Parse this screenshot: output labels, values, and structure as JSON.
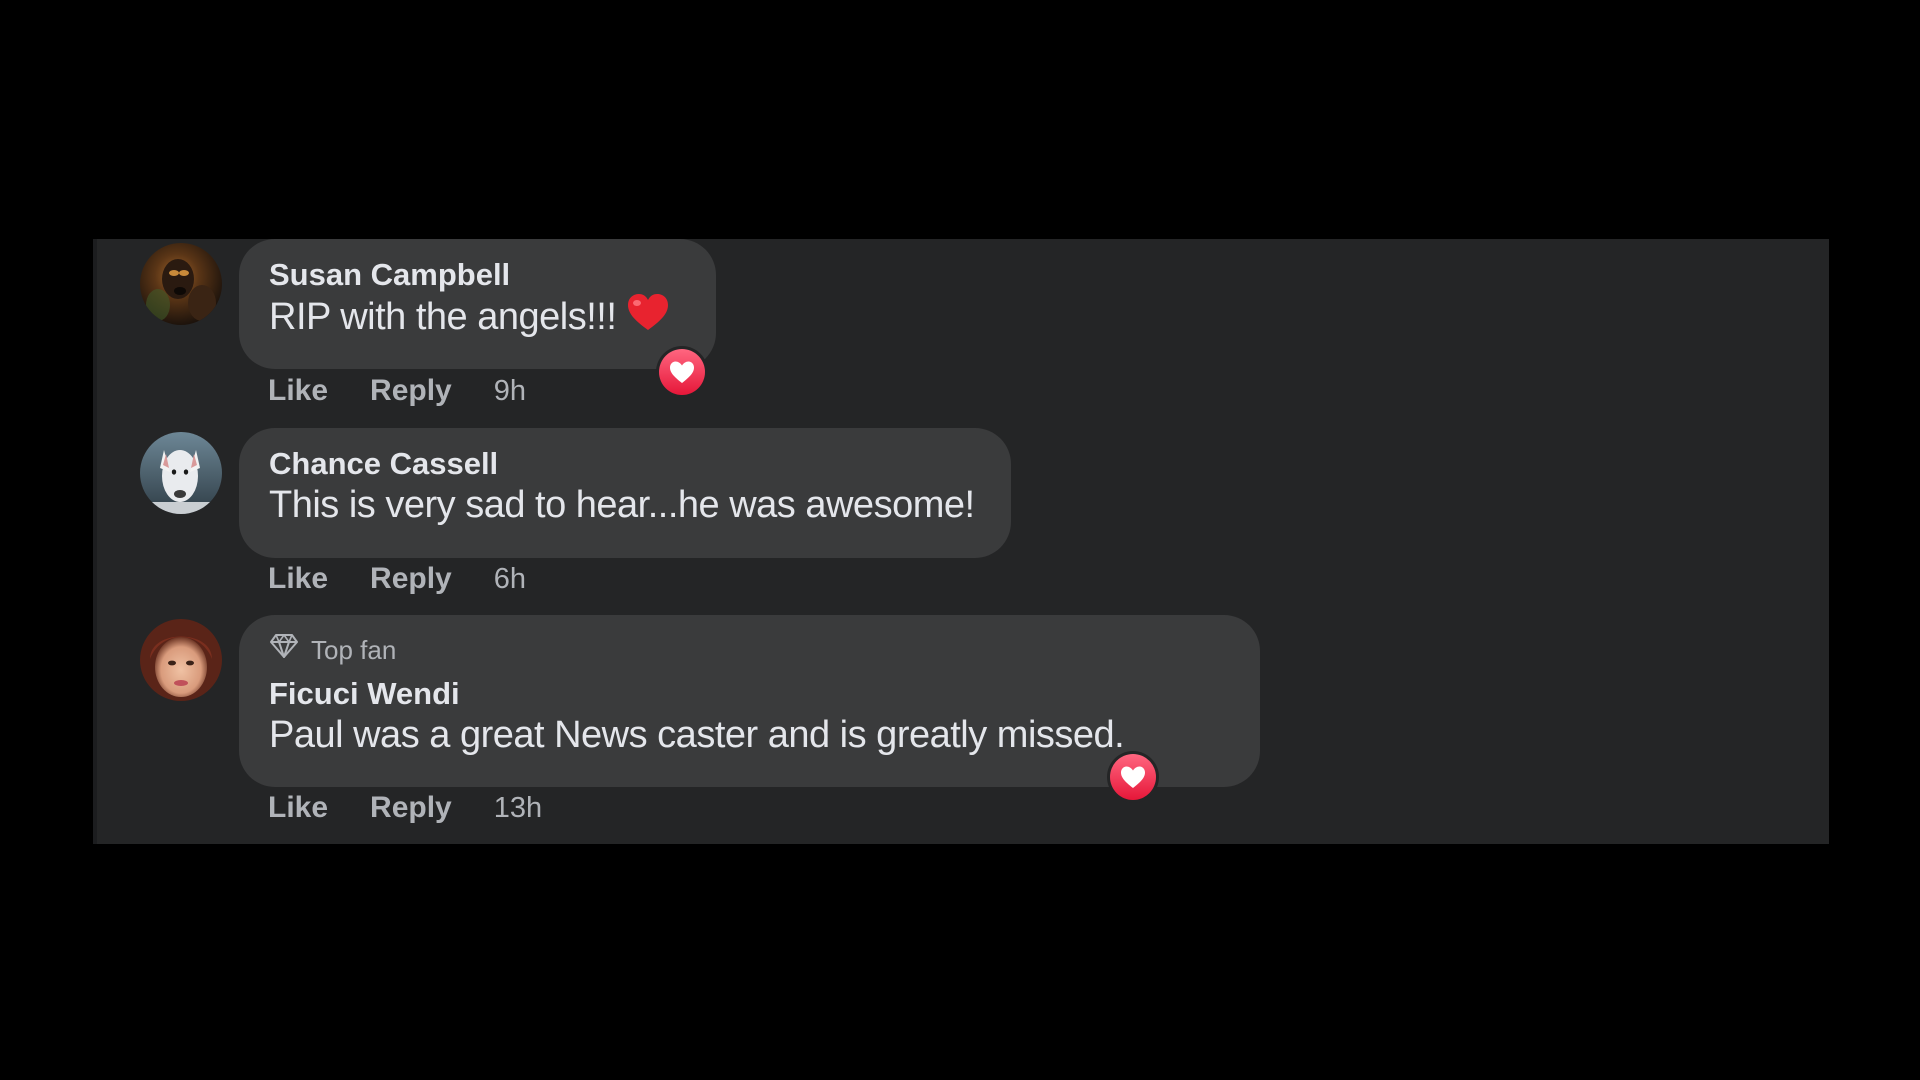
{
  "comments": [
    {
      "author": "Susan Campbell",
      "text": "RIP with the angels!!!",
      "inline_emoji": "red-heart-emoji",
      "reaction": "love-reaction",
      "like_label": "Like",
      "reply_label": "Reply",
      "time": "9h"
    },
    {
      "author": "Chance Cassell",
      "text": "This is very sad to hear...he was awesome!",
      "like_label": "Like",
      "reply_label": "Reply",
      "time": "6h"
    },
    {
      "badge_icon": "diamond-icon",
      "badge": "Top fan",
      "author": "Ficuci Wendi",
      "text": "Paul was a great News caster and is greatly missed.",
      "reaction": "love-reaction",
      "like_label": "Like",
      "reply_label": "Reply",
      "time": "13h"
    }
  ],
  "colors": {
    "page_background": "#000000",
    "panel_background": "#242526",
    "bubble_background": "#3a3b3c",
    "primary_text": "#e4e6eb",
    "secondary_text": "#b0b3b8",
    "love_reaction": "#f33e58"
  }
}
